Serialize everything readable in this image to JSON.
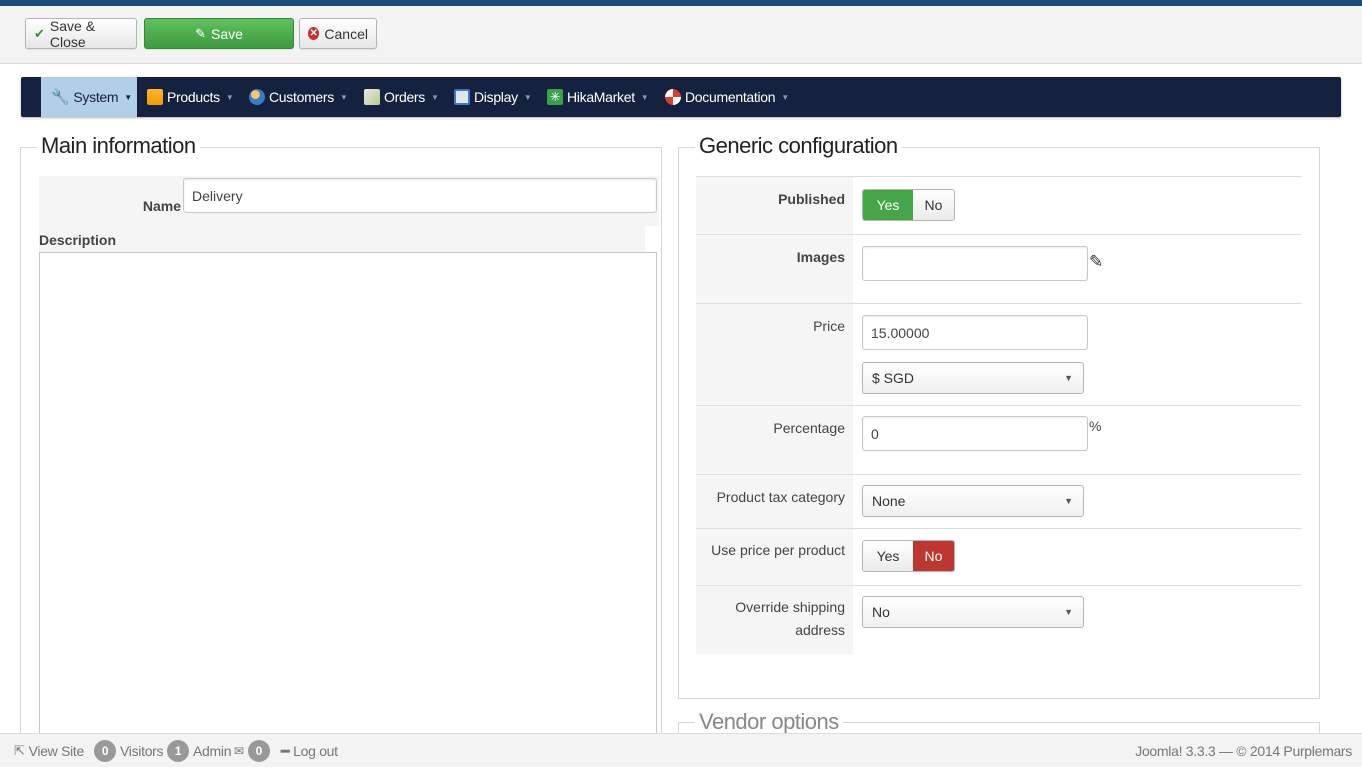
{
  "toolbar": {
    "save_close": "Save & Close",
    "save": "Save",
    "cancel": "Cancel"
  },
  "nav": {
    "items": [
      {
        "label": "System",
        "icon": "wrench-icon"
      },
      {
        "label": "Products",
        "icon": "products-icon"
      },
      {
        "label": "Customers",
        "icon": "customers-icon"
      },
      {
        "label": "Orders",
        "icon": "orders-icon"
      },
      {
        "label": "Display",
        "icon": "display-icon"
      },
      {
        "label": "HikaMarket",
        "icon": "hikamarket-icon"
      },
      {
        "label": "Documentation",
        "icon": "lifebuoy-icon"
      }
    ]
  },
  "main_info": {
    "legend": "Main information",
    "name_label": "Name",
    "name_value": "Delivery",
    "description_label": "Description"
  },
  "generic": {
    "legend": "Generic configuration",
    "published_label": "Published",
    "published_yes": "Yes",
    "published_no": "No",
    "images_label": "Images",
    "price_label": "Price",
    "price_value": "15.00000",
    "currency_value": "$ SGD",
    "percentage_label": "Percentage",
    "percentage_value": "0",
    "percent_sign": "%",
    "tax_label": "Product tax category",
    "tax_value": "None",
    "use_price_label": "Use price per product",
    "use_price_yes": "Yes",
    "use_price_no": "No",
    "override_label_1": "Override shipping",
    "override_label_2": "address",
    "override_value": "No"
  },
  "vendor": {
    "legend": "Vendor options"
  },
  "footer": {
    "view_site": "View Site",
    "visitors_count": "0",
    "visitors": "Visitors",
    "admin_count": "1",
    "admin": "Admin",
    "messages_count": "0",
    "logout": "Log out",
    "version": "Joomla! 3.3.3 — © 2014 Purplemars"
  },
  "colors": {
    "nav_bg": "#15223f",
    "save_green": "#46a546",
    "no_red": "#bd362f",
    "top_stripe": "#1d4b7e"
  }
}
